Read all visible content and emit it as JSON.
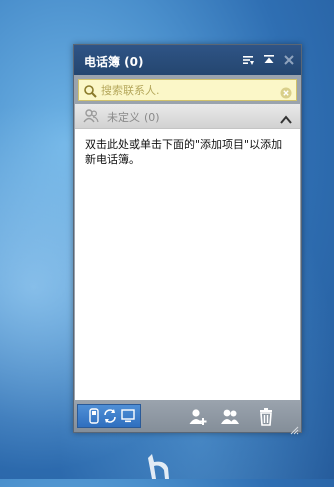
{
  "window": {
    "title": "电话簿 (0)"
  },
  "search": {
    "placeholder": "搜索联系人."
  },
  "group": {
    "name": "未定义",
    "count": "(0)"
  },
  "hint_text": "双击此处或单击下面的\"添加项目\"以添加新电话簿。",
  "colors": {
    "titlebar": "#2f5486",
    "search_bg": "#fbf7c8",
    "view_switch": "#3f7fcb"
  },
  "icons": {
    "title_buttons": [
      "sort-icon",
      "minimize-icon",
      "close-icon"
    ],
    "bottom_buttons": [
      "add-contact-icon",
      "contacts-group-icon",
      "delete-icon"
    ]
  }
}
